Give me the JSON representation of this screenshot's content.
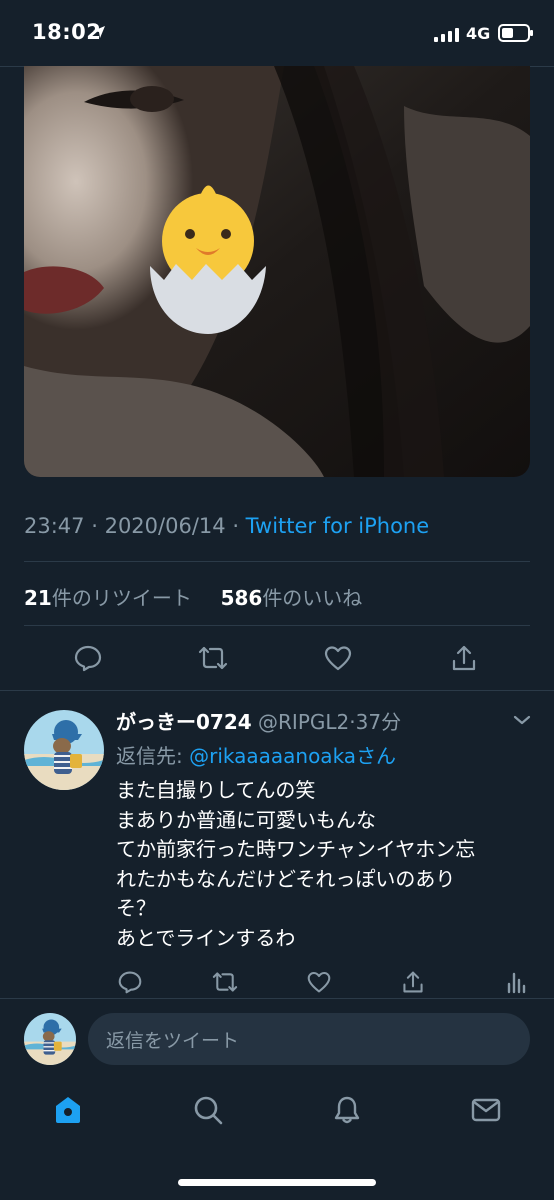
{
  "status": {
    "time": "18:02",
    "network": "4G"
  },
  "tweet": {
    "time": "23:47",
    "date": "2020/06/14",
    "source": "Twitter for iPhone",
    "retweets_count": "21",
    "retweets_label": "件のリツイート",
    "likes_count": "586",
    "likes_label": "件のいいね"
  },
  "reply": {
    "name": "がっきー0724",
    "handle": "@RIPGL2",
    "time": "37分",
    "reply_to_label": "返信先: ",
    "reply_to_handle": "@rikaaaaanoaka",
    "reply_to_suffix": "さん",
    "lines": [
      "また自撮りしてんの笑",
      "まありか普通に可愛いもんな",
      "てか前家行った時ワンチャンイヤホン忘",
      "れたかもなんだけどそれっぽいのあり",
      "そ？",
      "あとでラインするわ"
    ]
  },
  "composer": {
    "placeholder": "返信をツイート"
  },
  "icons": {
    "tweet_actions": [
      "reply-icon",
      "retweet-icon",
      "like-icon",
      "share-icon"
    ],
    "reply_actions": [
      "reply-icon",
      "retweet-icon",
      "like-icon",
      "share-icon",
      "analytics-icon"
    ],
    "tabs": [
      "home-icon",
      "search-icon",
      "notifications-icon",
      "messages-icon"
    ]
  },
  "colors": {
    "background": "#15202b",
    "accent": "#1da1f2",
    "muted": "#8899a6",
    "divider": "#2b3a48"
  }
}
